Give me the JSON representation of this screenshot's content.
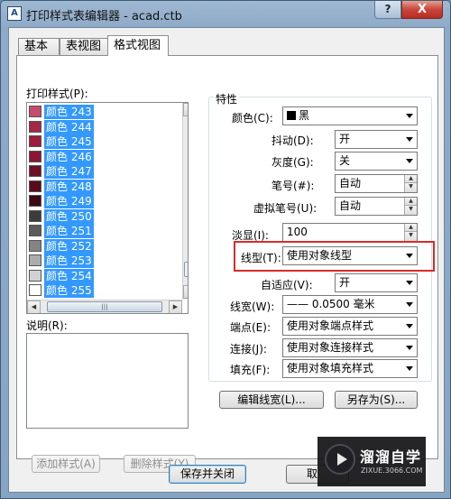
{
  "window": {
    "title": "打印样式表编辑器 - acad.ctb",
    "app_icon_text": "A",
    "help_symbol": "?",
    "close_symbol": "X"
  },
  "tabs": [
    {
      "label": "基本",
      "active": false
    },
    {
      "label": "表视图",
      "active": false
    },
    {
      "label": "格式视图",
      "active": true
    }
  ],
  "print_styles": {
    "label": "打印样式(P):",
    "items": [
      {
        "label": "颜色 243",
        "color": "#c74b6e"
      },
      {
        "label": "颜色 244",
        "color": "#a32748"
      },
      {
        "label": "颜色 245",
        "color": "#9e1c3c"
      },
      {
        "label": "颜色 246",
        "color": "#8a1633"
      },
      {
        "label": "颜色 247",
        "color": "#6e1024"
      },
      {
        "label": "颜色 248",
        "color": "#5a0c1c"
      },
      {
        "label": "颜色 249",
        "color": "#3a0a12"
      },
      {
        "label": "颜色 250",
        "color": "#3c3c3c"
      },
      {
        "label": "颜色 251",
        "color": "#5c5c5c"
      },
      {
        "label": "颜色 252",
        "color": "#848484"
      },
      {
        "label": "颜色 253",
        "color": "#acacac"
      },
      {
        "label": "颜色 254",
        "color": "#d2d2d2"
      },
      {
        "label": "颜色 255",
        "color": "#ffffff"
      }
    ]
  },
  "description": {
    "label": "说明(R):",
    "value": ""
  },
  "buttons": {
    "add_style": "添加样式(A)",
    "delete_style": "删除样式(Y)",
    "edit_lineweight": "编辑线宽(L)...",
    "save_as": "另存为(S)...",
    "save_close": "保存并关闭",
    "cancel": "取"
  },
  "properties": {
    "group_title": "特性",
    "color": {
      "label": "颜色(C):",
      "value": "黑"
    },
    "dither": {
      "label": "抖动(D):",
      "value": "开"
    },
    "grayscale": {
      "label": "灰度(G):",
      "value": "关"
    },
    "pen_number": {
      "label": "笔号(#):",
      "value": "自动"
    },
    "virtual_pen": {
      "label": "虚拟笔号(U):",
      "value": "自动"
    },
    "screening": {
      "label": "淡显(I):",
      "value": "100"
    },
    "linetype": {
      "label": "线型(T):",
      "value": "使用对象线型"
    },
    "adaptive": {
      "label": "自适应(V):",
      "value": "开"
    },
    "lineweight": {
      "label": "线宽(W):",
      "value": "—— 0.0500 毫米"
    },
    "line_end": {
      "label": "端点(E):",
      "value": "使用对象端点样式"
    },
    "line_join": {
      "label": "连接(J):",
      "value": "使用对象连接样式"
    },
    "fill": {
      "label": "填充(F):",
      "value": "使用对象填充样式"
    }
  },
  "watermark": {
    "title": "溜溜自学",
    "subtitle": "ZIXUE.3066.COM"
  },
  "colors": {
    "selection": "#3399ff",
    "highlight_border": "#d62c2c"
  }
}
